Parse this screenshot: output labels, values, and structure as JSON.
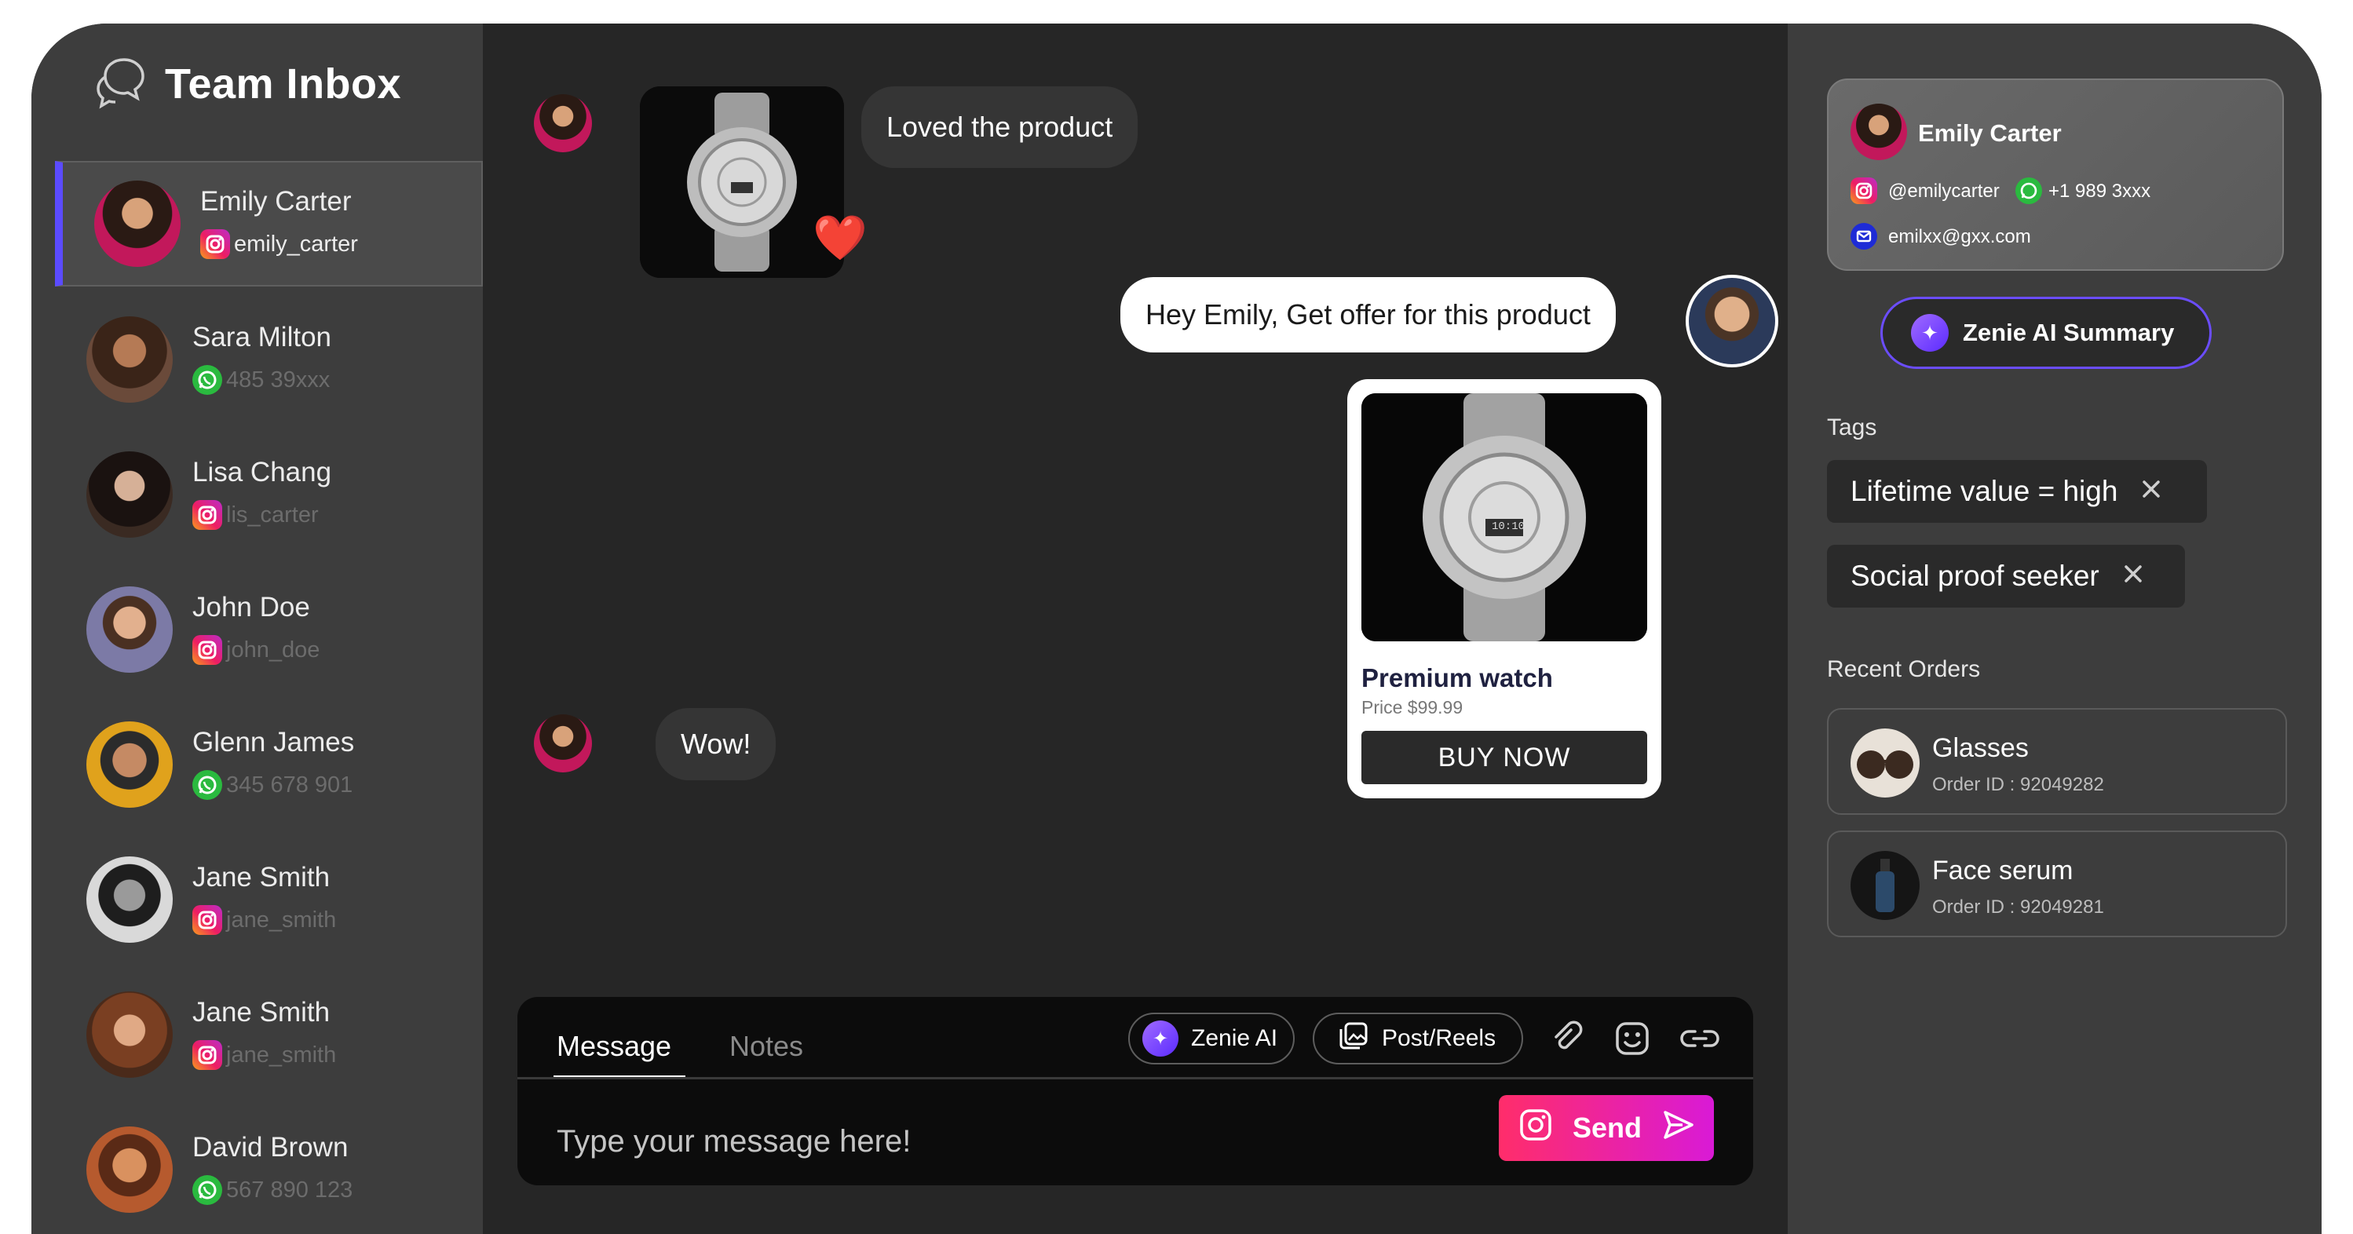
{
  "app": {
    "title": "Team Inbox"
  },
  "contacts": [
    {
      "name": "Emily Carter",
      "handle": "emily_carter",
      "channel": "instagram"
    },
    {
      "name": "Sara Milton",
      "handle": "485 39xxx",
      "channel": "whatsapp"
    },
    {
      "name": "Lisa Chang",
      "handle": "lis_carter",
      "channel": "instagram"
    },
    {
      "name": "John Doe",
      "handle": "john_doe",
      "channel": "instagram"
    },
    {
      "name": "Glenn James",
      "handle": "345 678 901",
      "channel": "whatsapp"
    },
    {
      "name": "Jane Smith",
      "handle": "jane_smith",
      "channel": "instagram"
    },
    {
      "name": "Jane Smith",
      "handle": "jane_smith",
      "channel": "instagram"
    },
    {
      "name": "David Brown",
      "handle": "567 890 123",
      "channel": "whatsapp"
    }
  ],
  "chat": {
    "messages": [
      {
        "text": "Loved the product",
        "direction": "incoming"
      },
      {
        "text": "Hey Emily, Get offer for this product",
        "direction": "outgoing"
      },
      {
        "text": "Wow!",
        "direction": "incoming"
      }
    ],
    "reaction": "❤️",
    "product": {
      "title": "Premium watch",
      "price": "Price $99.99",
      "button": "BUY NOW",
      "watch_time": "10:10"
    }
  },
  "composer": {
    "tabs": [
      {
        "label": "Message",
        "active": true
      },
      {
        "label": "Notes",
        "active": false
      }
    ],
    "ai_label": "Zenie AI",
    "post_label": "Post/Reels",
    "placeholder": "Type your message here!",
    "send_label": "Send",
    "tool_icons": [
      "attachment-icon",
      "emoji-icon",
      "link-icon"
    ]
  },
  "profile": {
    "name": "Emily Carter",
    "instagram": "@emilycarter",
    "phone": "+1 989 3xxx",
    "email": "emilxx@gxx.com"
  },
  "summary_button": "Zenie AI Summary",
  "tags": {
    "label": "Tags",
    "items": [
      "Lifetime value = high",
      "Social proof seeker"
    ]
  },
  "orders": {
    "label": "Recent Orders",
    "items": [
      {
        "name": "Glasses",
        "order_id": "Order ID : 92049282"
      },
      {
        "name": "Face serum",
        "order_id": "Order ID : 92049281"
      }
    ]
  },
  "colors": {
    "accent": "#5b4bff",
    "send_gradient_start": "#ff2d6a",
    "send_gradient_end": "#d91ad6",
    "whatsapp": "#2aba3f",
    "instagram": "#ee1d62"
  }
}
